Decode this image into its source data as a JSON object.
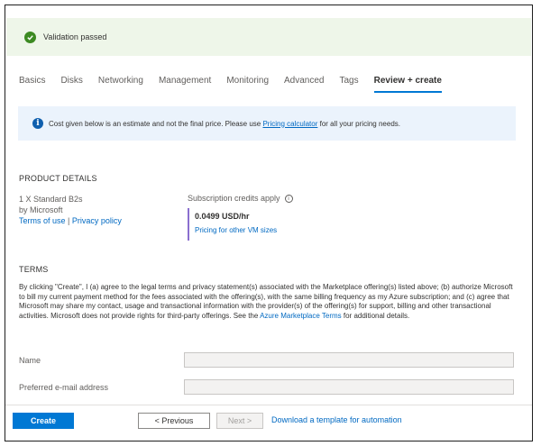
{
  "validation": {
    "text": "Validation passed"
  },
  "tabs": [
    {
      "label": "Basics"
    },
    {
      "label": "Disks"
    },
    {
      "label": "Networking"
    },
    {
      "label": "Management"
    },
    {
      "label": "Monitoring"
    },
    {
      "label": "Advanced"
    },
    {
      "label": "Tags"
    },
    {
      "label": "Review + create",
      "active": true
    }
  ],
  "info": {
    "text_before": "Cost given below is an estimate and not the final price. Please use ",
    "link": "Pricing calculator",
    "text_after": " for all your pricing needs."
  },
  "product": {
    "title": "PRODUCT DETAILS",
    "name": "1 X Standard B2s",
    "vendor": "by Microsoft",
    "terms_link": "Terms of use",
    "separator": " | ",
    "privacy_link": "Privacy policy",
    "credits_label": "Subscription credits apply",
    "price": "0.0499 USD/hr",
    "pricing_link": "Pricing for other VM sizes"
  },
  "terms": {
    "title": "TERMS",
    "text_before": "By clicking \"Create\", I (a) agree to the legal terms and privacy statement(s) associated with the Marketplace offering(s) listed above; (b) authorize Microsoft to bill my current payment method for the fees associated with the offering(s), with the same billing frequency as my Azure subscription; and (c) agree that Microsoft may share my contact, usage and transactional information with the provider(s) of the offering(s) for support, billing and other transactional activities. Microsoft does not provide rights for third-party offerings. See the ",
    "link": "Azure Marketplace Terms",
    "text_after": " for additional details."
  },
  "form": {
    "name_label": "Name",
    "name_value": "",
    "email_label": "Preferred e-mail address",
    "email_value": ""
  },
  "footer": {
    "create_label": "Create",
    "previous_label": "< Previous",
    "next_label": "Next >",
    "download_link": "Download a template for automation"
  },
  "colors": {
    "primary": "#0078d4",
    "success": "#3c8a22",
    "validation_bg": "#eef6e9",
    "info_bg": "#ebf3fc",
    "price_accent": "#8a6fcf"
  }
}
